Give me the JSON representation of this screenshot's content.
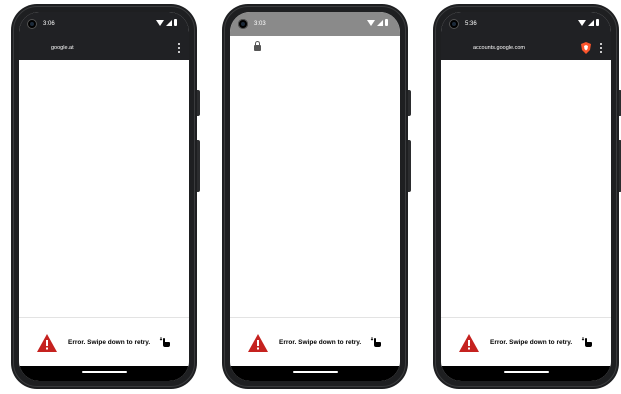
{
  "colors": {
    "status_dark": "#202124",
    "status_gray": "#8a8a8a",
    "warning_red": "#c5221f",
    "brave_orange": "#fb542b"
  },
  "phones": [
    {
      "time": "3:06",
      "url": "google.at",
      "status_style": "dark",
      "toolbar_style": "dark",
      "icons": [
        "wifi-icon",
        "signal-icon",
        "battery-icon",
        "more-vert-icon"
      ],
      "error_text": "Error. Swipe down to retry."
    },
    {
      "time": "3:03",
      "url": "",
      "status_style": "gray",
      "toolbar_style": "light",
      "icons": [
        "wifi-icon",
        "signal-icon",
        "battery-icon",
        "lock-icon"
      ],
      "error_text": "Error. Swipe down to retry."
    },
    {
      "time": "5:36",
      "url": "accounts.google.com",
      "status_style": "dark",
      "toolbar_style": "dark",
      "icons": [
        "wifi-icon",
        "signal-icon",
        "battery-icon",
        "brave-shield-icon",
        "more-vert-icon"
      ],
      "error_text": "Error. Swipe down to retry."
    }
  ]
}
